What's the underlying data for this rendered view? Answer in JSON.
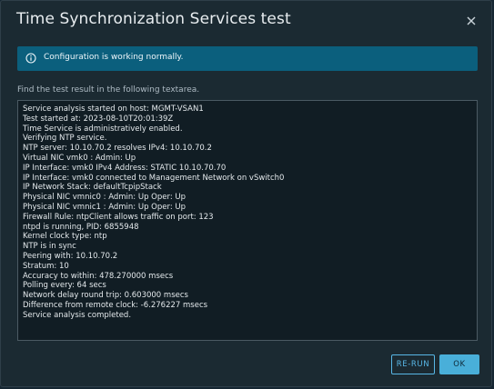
{
  "dialog": {
    "title": "Time Synchronization Services test"
  },
  "alert": {
    "message": "Configuration is working normally."
  },
  "instruction": "Find the test result in the following textarea.",
  "results": {
    "lines": [
      "Service analysis started on host: MGMT-VSAN1",
      "Test started at: 2023-08-10T20:01:39Z",
      "Time Service is administratively enabled.",
      "Verifying NTP service.",
      "NTP server: 10.10.70.2 resolves IPv4: 10.10.70.2",
      "Virtual NIC vmk0 : Admin: Up",
      "IP Interface: vmk0 IPv4 Address: STATIC 10.10.70.70",
      "IP Interface: vmk0 connected to Management Network on vSwitch0",
      "IP Network Stack: defaultTcpipStack",
      "Physical NIC vmnic0 : Admin: Up Oper: Up",
      "Physical NIC vmnic1 : Admin: Up Oper: Up",
      "Firewall Rule: ntpClient allows traffic on port: 123",
      "ntpd is running, PID: 6855948",
      "Kernel clock type: ntp",
      "NTP is in sync",
      "Peering with: 10.10.70.2",
      "Stratum: 10",
      "Accuracy to within: 478.270000 msecs",
      "Polling every: 64 secs",
      "Network delay round trip: 0.603000 msecs",
      "Difference from remote clock: -6.276227 msecs",
      "Service analysis completed."
    ]
  },
  "buttons": {
    "rerun": "RE-RUN",
    "ok": "OK"
  },
  "colors": {
    "dialog_bg": "#1b2a32",
    "alert_bg": "#0b5f7d",
    "accent": "#49afd9"
  },
  "icons": {
    "close": "close-icon",
    "alert": "info-circle-icon"
  }
}
